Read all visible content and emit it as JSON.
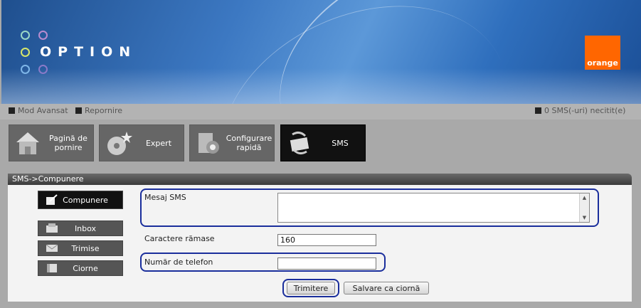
{
  "header": {
    "logo_text": "OPTION",
    "brand_label": "orange"
  },
  "status": {
    "advanced_mode": "Mod Avansat",
    "restart": "Repornire",
    "unread_sms": "0 SMS(-uri) necitit(e)"
  },
  "nav": [
    {
      "label": "Pagină de pornire",
      "icon": "house-icon"
    },
    {
      "label": "Expert",
      "icon": "disc-icon"
    },
    {
      "label": "Configurare rapidă",
      "icon": "toolbox-icon"
    },
    {
      "label": "SMS",
      "icon": "sms-icon"
    }
  ],
  "panel": {
    "title": "SMS->Compunere"
  },
  "sidebar": [
    {
      "label": "Compunere",
      "icon": "compose-icon"
    },
    {
      "label": "Inbox",
      "icon": "inbox-icon"
    },
    {
      "label": "Trimise",
      "icon": "sent-icon"
    },
    {
      "label": "Ciorne",
      "icon": "drafts-icon"
    }
  ],
  "form": {
    "message_label": "Mesaj SMS",
    "message_value": "",
    "remaining_label": "Caractere rămase",
    "remaining_value": "160",
    "phone_label": "Număr de telefon",
    "phone_value": "",
    "send_button": "Trimitere",
    "save_draft_button": "Salvare ca ciornă"
  },
  "colors": {
    "brand": "#ff6600",
    "highlight": "#1a2e9c",
    "active_tile": "#111111"
  }
}
